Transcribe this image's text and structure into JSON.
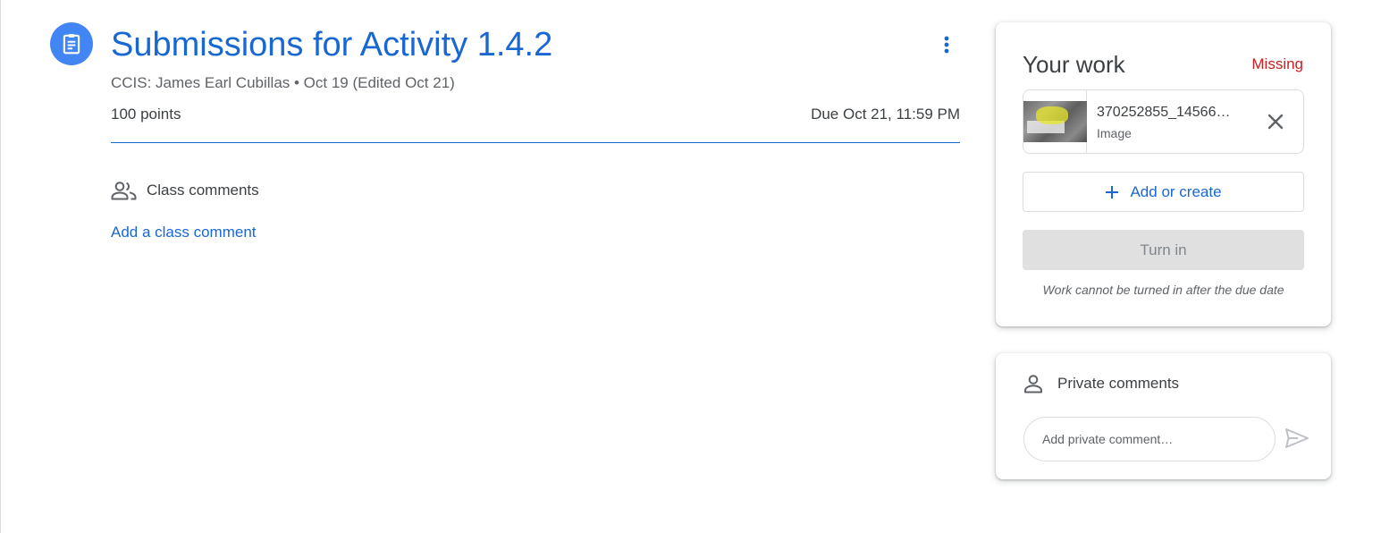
{
  "assignment": {
    "title": "Submissions for Activity 1.4.2",
    "meta": "CCIS: James Earl Cubillas • Oct 19 (Edited Oct 21)",
    "points": "100 points",
    "due": "Due Oct 21, 11:59 PM"
  },
  "class_comments": {
    "heading": "Class comments",
    "add_link": "Add a class comment"
  },
  "your_work": {
    "title": "Your work",
    "status": "Missing",
    "attachment": {
      "name": "370252855_14566…",
      "type": "Image"
    },
    "add_create_label": "Add or create",
    "turn_in_label": "Turn in",
    "note": "Work cannot be turned in after the due date"
  },
  "private_comments": {
    "heading": "Private comments",
    "placeholder": "Add private comment…"
  },
  "colors": {
    "accent": "#1967d2",
    "icon_bg": "#4285f4",
    "missing": "#c5221f",
    "disabled_bg": "#e0e0e0"
  },
  "icons": {
    "assignment": "assignment-icon",
    "more": "more-vert-icon",
    "class_comments": "people-icon",
    "remove": "close-icon",
    "add": "plus-icon",
    "private_comments": "person-icon",
    "send": "send-icon"
  }
}
